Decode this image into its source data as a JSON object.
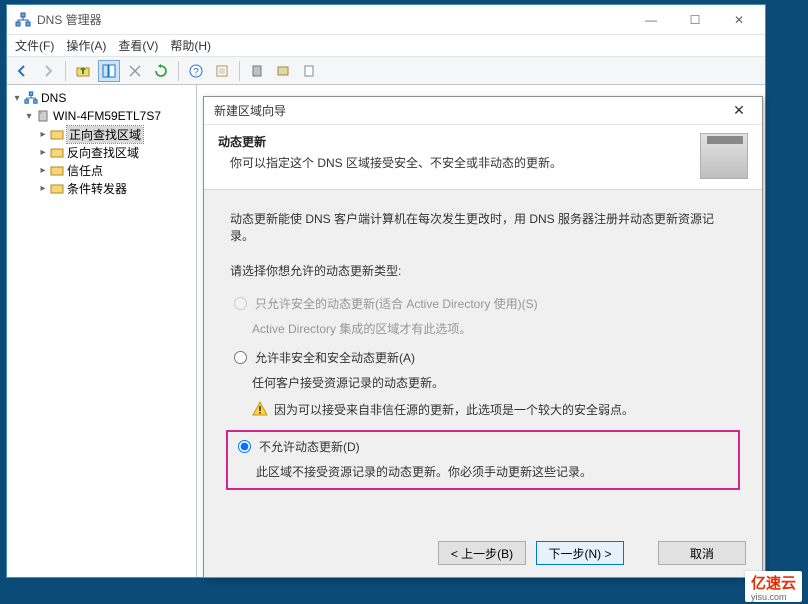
{
  "window": {
    "title": "DNS 管理器",
    "menus": [
      "文件(F)",
      "操作(A)",
      "查看(V)",
      "帮助(H)"
    ],
    "win_controls": {
      "min": "—",
      "max": "☐",
      "close": "✕"
    }
  },
  "tree": {
    "root": "DNS",
    "server": "WIN-4FM59ETL7S7",
    "nodes": [
      "正向查找区域",
      "反向查找区域",
      "信任点",
      "条件转发器"
    ]
  },
  "wizard": {
    "title": "新建区域向导",
    "header_title": "动态更新",
    "header_sub": "你可以指定这个 DNS 区域接受安全、不安全或非动态的更新。",
    "intro": "动态更新能使 DNS 客户端计算机在每次发生更改时，用 DNS 服务器注册并动态更新资源记录。",
    "prompt": "请选择你想允许的动态更新类型:",
    "opt1_label": "只允许安全的动态更新(适合 Active Directory 使用)(S)",
    "opt1_desc": "Active Directory 集成的区域才有此选项。",
    "opt2_label": "允许非安全和安全动态更新(A)",
    "opt2_desc": "任何客户接受资源记录的动态更新。",
    "opt2_warn": "因为可以接受来自非信任源的更新，此选项是一个较大的安全弱点。",
    "opt3_label": "不允许动态更新(D)",
    "opt3_desc": "此区域不接受资源记录的动态更新。你必须手动更新这些记录。",
    "back": "< 上一步(B)",
    "next": "下一步(N) >",
    "cancel": "取消"
  },
  "watermark": {
    "main": "亿速云",
    "sub": "yisu.com"
  }
}
